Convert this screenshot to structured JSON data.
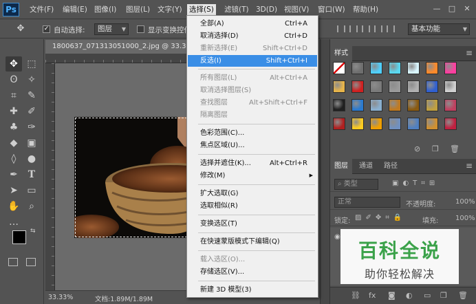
{
  "app": {
    "logo": "Ps"
  },
  "menubar": {
    "items": [
      "文件(F)",
      "编辑(E)",
      "图像(I)",
      "图层(L)",
      "文字(Y)",
      "选择(S)",
      "滤镜(T)",
      "3D(D)",
      "视图(V)",
      "窗口(W)",
      "帮助(H)"
    ],
    "active": "选择(S)",
    "window_controls": [
      "—",
      "□",
      "✕"
    ]
  },
  "options_bar": {
    "move_icon": "move-tool-icon",
    "auto_select_label": "自动选择:",
    "auto_select_checked": true,
    "auto_select_value": "图层",
    "show_transform_label": "显示变换控件",
    "show_transform_checked": false,
    "workspace_value": "基本功能"
  },
  "document": {
    "tab_title": "1800637_071313051000_2.jpg @ 33.3%(RGB/8)",
    "zoom": "33.33%",
    "doc_info": "文档:1.89M/1.89M"
  },
  "select_menu": {
    "items": [
      {
        "label": "全部(A)",
        "shortcut": "Ctrl+A",
        "enabled": true
      },
      {
        "label": "取消选择(D)",
        "shortcut": "Ctrl+D",
        "enabled": true
      },
      {
        "label": "重新选择(E)",
        "shortcut": "Shift+Ctrl+D",
        "enabled": false
      },
      {
        "label": "反选(I)",
        "shortcut": "Shift+Ctrl+I",
        "enabled": true,
        "highlighted": true
      },
      {
        "label": "所有图层(L)",
        "shortcut": "Alt+Ctrl+A",
        "enabled": false
      },
      {
        "label": "取消选择图层(S)",
        "shortcut": "",
        "enabled": false
      },
      {
        "label": "查找图层",
        "shortcut": "Alt+Shift+Ctrl+F",
        "enabled": false
      },
      {
        "label": "隔离图层",
        "shortcut": "",
        "enabled": false
      },
      {
        "label": "色彩范围(C)...",
        "shortcut": "",
        "enabled": true
      },
      {
        "label": "焦点区域(U)...",
        "shortcut": "",
        "enabled": true
      },
      {
        "label": "选择并遮住(K)...",
        "shortcut": "Alt+Ctrl+R",
        "enabled": true
      },
      {
        "label": "修改(M)",
        "shortcut": "",
        "enabled": true,
        "submenu": true
      },
      {
        "label": "扩大选取(G)",
        "shortcut": "",
        "enabled": true
      },
      {
        "label": "选取相似(R)",
        "shortcut": "",
        "enabled": true
      },
      {
        "label": "变换选区(T)",
        "shortcut": "",
        "enabled": true
      },
      {
        "label": "在快速蒙版模式下编辑(Q)",
        "shortcut": "",
        "enabled": true
      },
      {
        "label": "载入选区(O)...",
        "shortcut": "",
        "enabled": false
      },
      {
        "label": "存储选区(V)...",
        "shortcut": "",
        "enabled": true
      },
      {
        "label": "新建 3D 模型(3)",
        "shortcut": "",
        "enabled": true
      }
    ]
  },
  "styles_panel": {
    "tab": "样式"
  },
  "layers_panel": {
    "tabs": [
      "图层",
      "通道",
      "路径"
    ],
    "filter_label": "类型",
    "blend_mode": "正常",
    "opacity_label": "不透明度:",
    "opacity_value": "100%",
    "lock_label": "锁定:",
    "fill_label": "填充:",
    "fill_value": "100%"
  },
  "watermark": {
    "title": "百科全说",
    "subtitle": "助你轻松解决"
  },
  "colors": {
    "menu_highlight": "#3a8ee6",
    "panel_bg": "#535353",
    "ps_blue": "#4fb3ff",
    "watermark_green": "#3aa54a"
  }
}
